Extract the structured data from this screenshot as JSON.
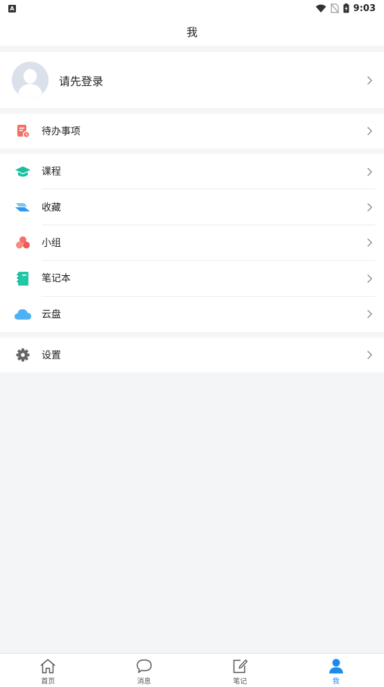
{
  "status_bar": {
    "time": "9:03",
    "badge": "A"
  },
  "header": {
    "title": "我"
  },
  "profile": {
    "login_prompt": "请先登录"
  },
  "todo": {
    "label": "待办事项"
  },
  "menu": {
    "items": [
      {
        "label": "课程"
      },
      {
        "label": "收藏"
      },
      {
        "label": "小组"
      },
      {
        "label": "笔记本"
      },
      {
        "label": "云盘"
      }
    ]
  },
  "settings": {
    "label": "设置"
  },
  "tabs": [
    {
      "label": "首页"
    },
    {
      "label": "消息"
    },
    {
      "label": "笔记"
    },
    {
      "label": "我"
    }
  ],
  "colors": {
    "active_tab": "#1a8cf0",
    "course_icon": "#18c0a0",
    "favorite_icon": "#3aa0f0",
    "group_icon": "#f27066",
    "notebook_icon": "#22c7a8",
    "cloud_icon": "#4cb1f5",
    "todo_icon": "#f27066"
  }
}
